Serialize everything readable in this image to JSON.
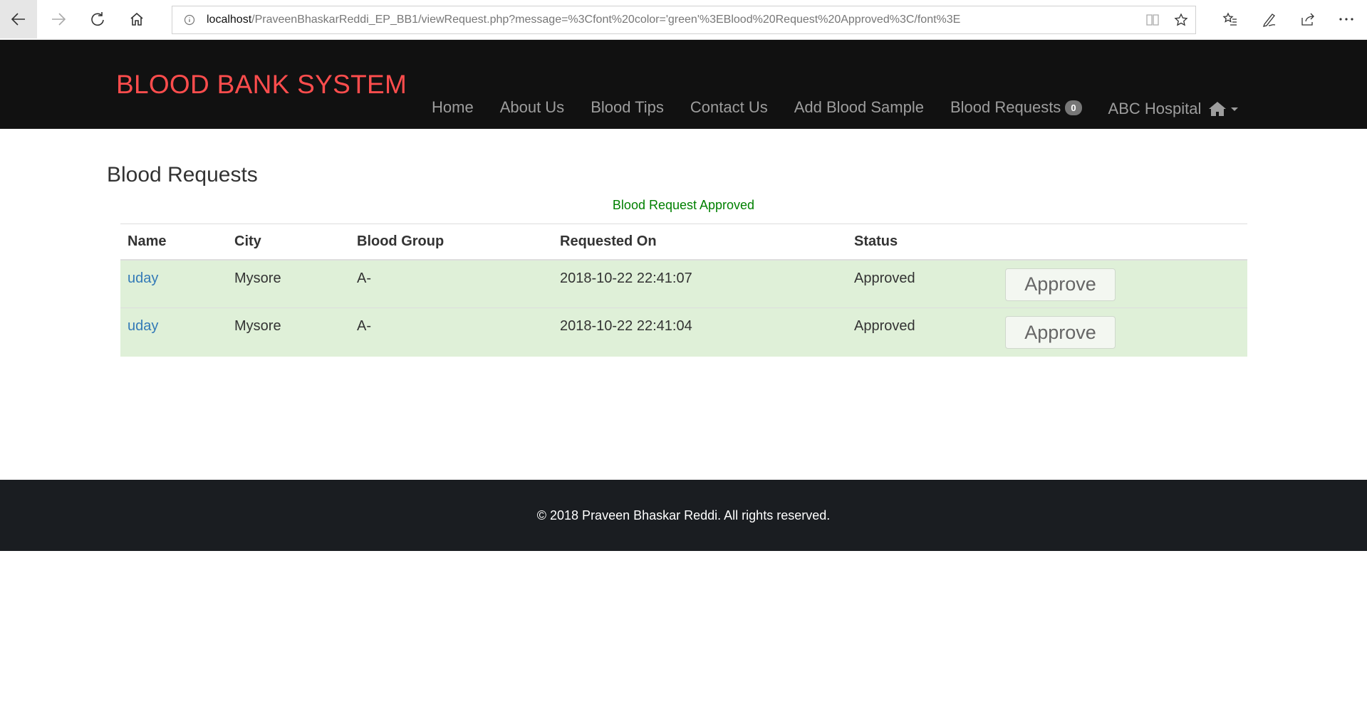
{
  "browser": {
    "url_host": "localhost",
    "url_path": "/PraveenBhaskarReddi_EP_BB1/viewRequest.php?message=%3Cfont%20color='green'%3EBlood%20Request%20Approved%3C/font%3E",
    "icons": [
      "back-icon",
      "forward-icon",
      "refresh-icon",
      "home-icon",
      "info-icon",
      "reading-view-icon",
      "favorite-star-icon",
      "favorites-list-icon",
      "pen-icon",
      "share-icon",
      "more-icon"
    ]
  },
  "header": {
    "brand": "BLOOD BANK SYSTEM",
    "brand_color": "#ff4d4d",
    "nav": {
      "home": "Home",
      "about": "About Us",
      "tips": "Blood Tips",
      "contact": "Contact Us",
      "add_sample": "Add Blood Sample",
      "requests": "Blood Requests",
      "requests_count": "0",
      "account": "ABC Hospital"
    }
  },
  "main": {
    "title": "Blood Requests",
    "message": "Blood Request Approved",
    "message_color": "#008000",
    "table": {
      "columns": [
        "Name",
        "City",
        "Blood Group",
        "Requested On",
        "Status"
      ],
      "rows": [
        {
          "name": "uday",
          "city": "Mysore",
          "blood_group": "A-",
          "requested_on": "2018-10-22 22:41:07",
          "status": "Approved",
          "action": "Approve"
        },
        {
          "name": "uday",
          "city": "Mysore",
          "blood_group": "A-",
          "requested_on": "2018-10-22 22:41:04",
          "status": "Approved",
          "action": "Approve"
        }
      ]
    }
  },
  "footer": {
    "text": "© 2018 Praveen Bhaskar Reddi. All rights reserved."
  }
}
